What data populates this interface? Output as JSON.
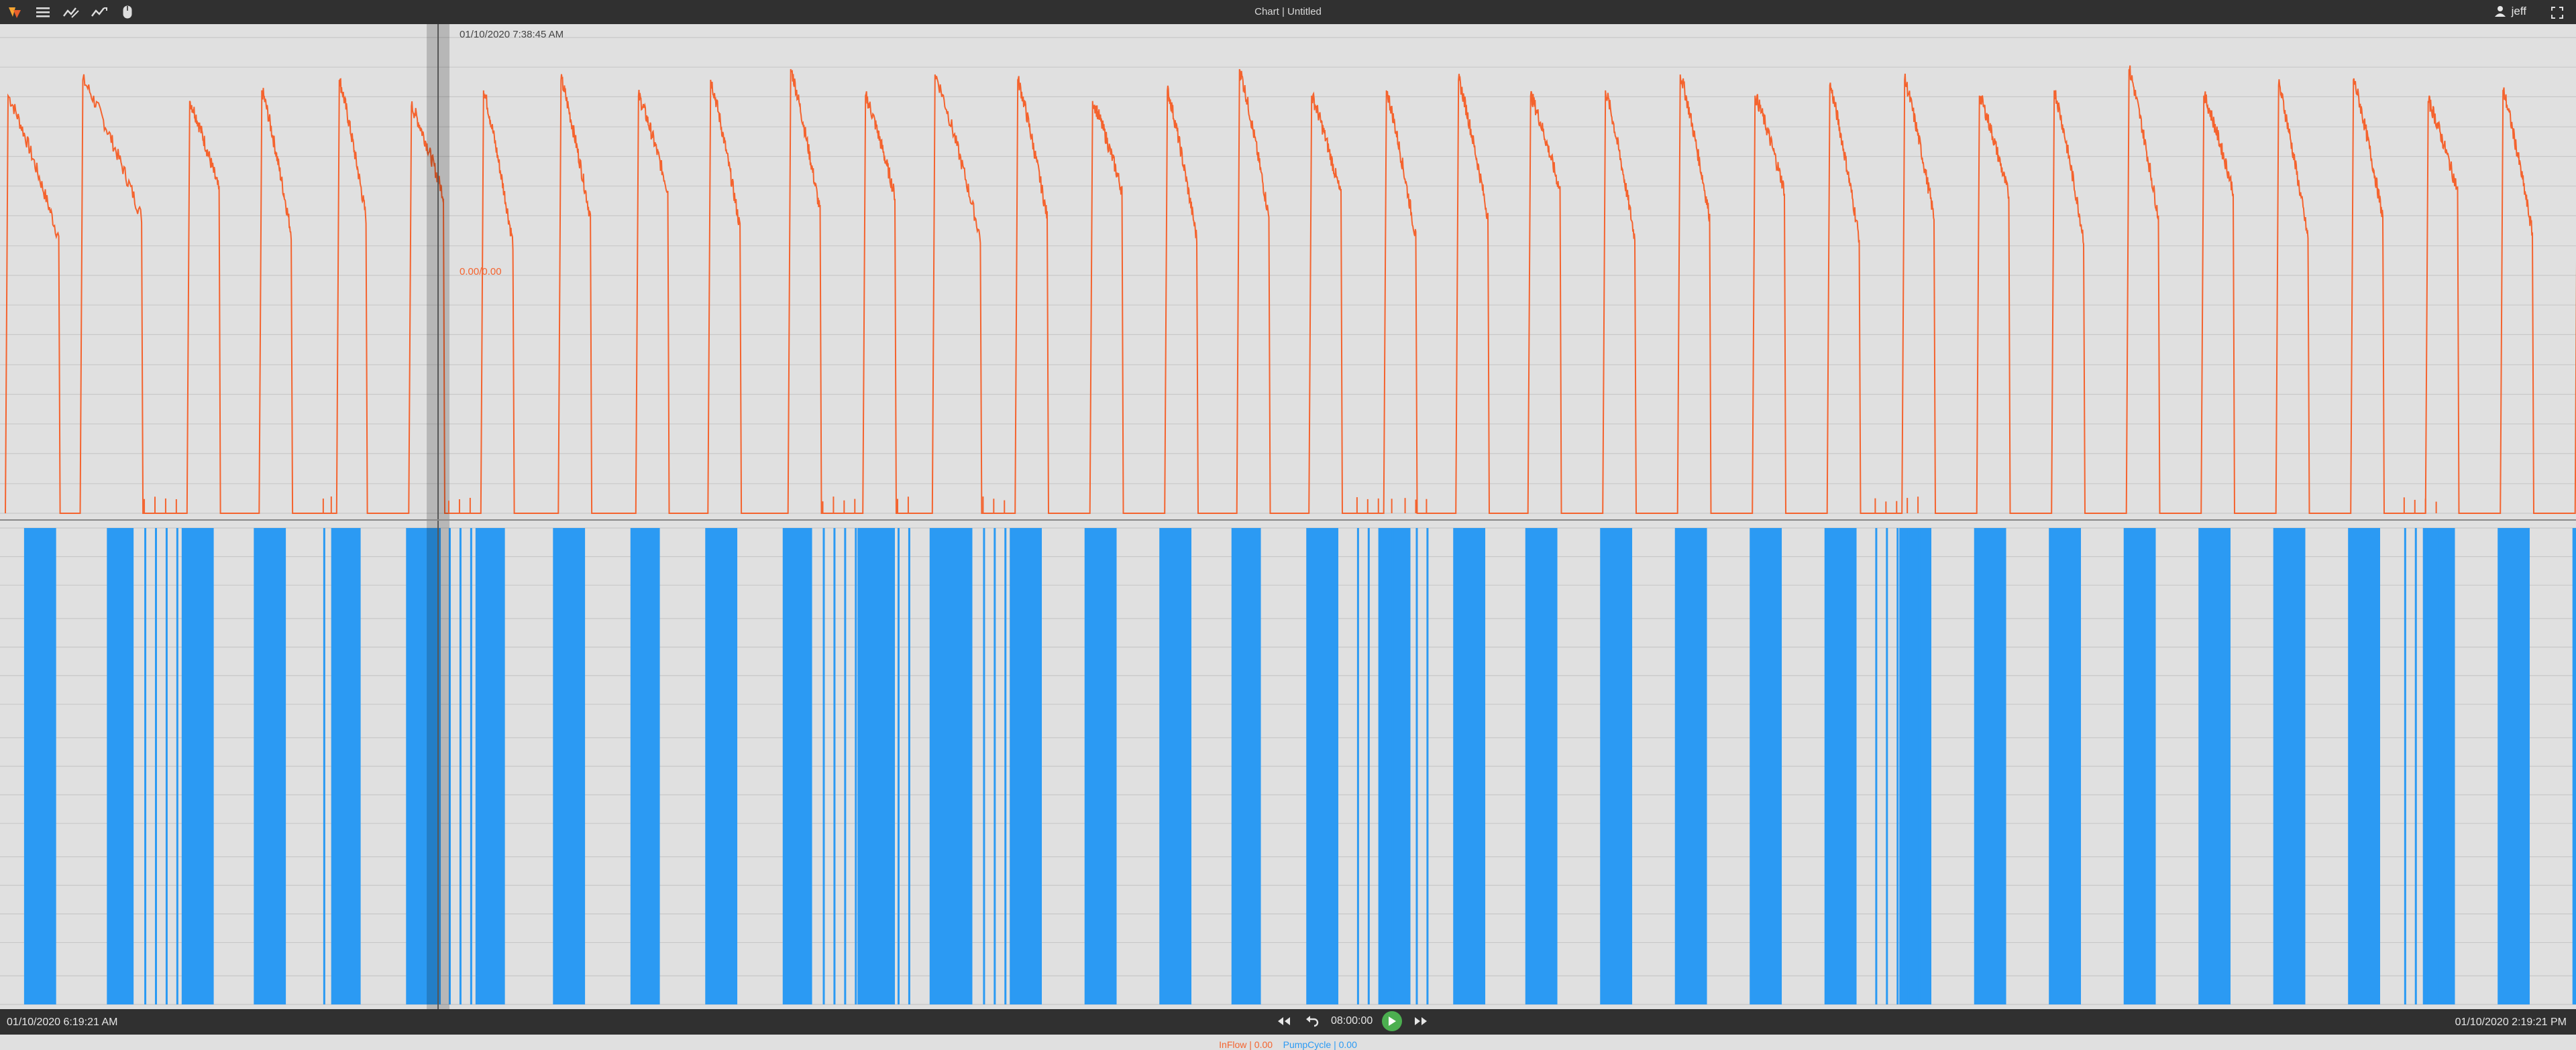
{
  "app": {
    "title": "Chart | Untitled",
    "user": "jeff"
  },
  "toolbar": {
    "icons": [
      "logo-icon",
      "menu-icon",
      "line-chart-icon",
      "line-chart-alt-icon",
      "mouse-icon"
    ]
  },
  "cursor": {
    "timestamp": "01/10/2020 7:38:45 AM",
    "readout": "0.00/0.00"
  },
  "timeline": {
    "start": "01/10/2020 6:19:21 AM",
    "end": "01/10/2020 2:19:21 PM",
    "duration": "08:00:00"
  },
  "legend": [
    {
      "label": "InFlow | 0.00",
      "color": "#f4632e"
    },
    {
      "label": "PumpCycle | 0.00",
      "color": "#2b9af3"
    }
  ],
  "colors": {
    "inflow": "#f4632e",
    "pump": "#2b9af3",
    "background": "#e0e0e0",
    "bar": "#303030"
  },
  "chart_data": [
    {
      "type": "line",
      "series": [
        {
          "name": "InFlow"
        }
      ],
      "yticks": [
        0,
        56,
        113,
        169,
        225,
        281,
        338,
        394,
        450,
        506,
        563,
        619,
        675,
        731,
        788,
        844,
        900
      ],
      "ylim": [
        0,
        900
      ],
      "cycles": [
        {
          "s": 0.0,
          "e": 0.02,
          "pk": 790,
          "lo": 520
        },
        {
          "s": 0.028,
          "e": 0.051,
          "pk": 820,
          "lo": 560
        },
        {
          "s": 0.068,
          "e": 0.08,
          "pk": 780,
          "lo": 610
        },
        {
          "s": 0.095,
          "e": 0.107,
          "pk": 800,
          "lo": 530
        },
        {
          "s": 0.124,
          "e": 0.135,
          "pk": 820,
          "lo": 560
        },
        {
          "s": 0.151,
          "e": 0.164,
          "pk": 770,
          "lo": 600
        },
        {
          "s": 0.178,
          "e": 0.19,
          "pk": 800,
          "lo": 510
        },
        {
          "s": 0.207,
          "e": 0.219,
          "pk": 820,
          "lo": 560
        },
        {
          "s": 0.236,
          "e": 0.248,
          "pk": 790,
          "lo": 610
        },
        {
          "s": 0.263,
          "e": 0.275,
          "pk": 820,
          "lo": 540
        },
        {
          "s": 0.293,
          "e": 0.305,
          "pk": 840,
          "lo": 570
        },
        {
          "s": 0.321,
          "e": 0.333,
          "pk": 790,
          "lo": 600
        },
        {
          "s": 0.347,
          "e": 0.365,
          "pk": 830,
          "lo": 520
        },
        {
          "s": 0.378,
          "e": 0.39,
          "pk": 820,
          "lo": 560
        },
        {
          "s": 0.406,
          "e": 0.418,
          "pk": 780,
          "lo": 610
        },
        {
          "s": 0.434,
          "e": 0.446,
          "pk": 800,
          "lo": 520
        },
        {
          "s": 0.461,
          "e": 0.473,
          "pk": 840,
          "lo": 560
        },
        {
          "s": 0.488,
          "e": 0.5,
          "pk": 790,
          "lo": 600
        },
        {
          "s": 0.516,
          "e": 0.528,
          "pk": 800,
          "lo": 520
        },
        {
          "s": 0.543,
          "e": 0.555,
          "pk": 820,
          "lo": 560
        },
        {
          "s": 0.57,
          "e": 0.582,
          "pk": 790,
          "lo": 610
        },
        {
          "s": 0.598,
          "e": 0.61,
          "pk": 800,
          "lo": 520
        },
        {
          "s": 0.626,
          "e": 0.638,
          "pk": 830,
          "lo": 560
        },
        {
          "s": 0.654,
          "e": 0.666,
          "pk": 790,
          "lo": 610
        },
        {
          "s": 0.682,
          "e": 0.694,
          "pk": 810,
          "lo": 520
        },
        {
          "s": 0.71,
          "e": 0.722,
          "pk": 820,
          "lo": 560
        },
        {
          "s": 0.738,
          "e": 0.75,
          "pk": 790,
          "lo": 600
        },
        {
          "s": 0.766,
          "e": 0.778,
          "pk": 800,
          "lo": 520
        },
        {
          "s": 0.794,
          "e": 0.806,
          "pk": 840,
          "lo": 560
        },
        {
          "s": 0.822,
          "e": 0.834,
          "pk": 790,
          "lo": 610
        },
        {
          "s": 0.85,
          "e": 0.862,
          "pk": 810,
          "lo": 520
        },
        {
          "s": 0.878,
          "e": 0.89,
          "pk": 820,
          "lo": 560
        },
        {
          "s": 0.906,
          "e": 0.918,
          "pk": 780,
          "lo": 610
        },
        {
          "s": 0.934,
          "e": 0.946,
          "pk": 800,
          "lo": 530
        },
        {
          "s": 0.962,
          "e": 0.976,
          "pk": 830,
          "lo": 570
        }
      ]
    },
    {
      "type": "bar",
      "series": [
        {
          "name": "PumpCycle"
        }
      ],
      "yticks": [
        "1.00",
        "0.94",
        "0.88",
        "0.81",
        "0.75",
        "0.69",
        "0.63",
        "0.56",
        "0.50",
        "0.44",
        "0.38",
        "0.31",
        "0.25",
        "0.19",
        "0.13",
        "0.06",
        "0.00"
      ],
      "ylim": [
        0,
        1
      ],
      "on_intervals": [
        [
          0.007,
          0.019
        ],
        [
          0.038,
          0.048
        ],
        [
          0.066,
          0.078
        ],
        [
          0.093,
          0.105
        ],
        [
          0.122,
          0.133
        ],
        [
          0.15,
          0.163
        ],
        [
          0.176,
          0.187
        ],
        [
          0.205,
          0.217
        ],
        [
          0.234,
          0.245
        ],
        [
          0.262,
          0.274
        ],
        [
          0.291,
          0.302
        ],
        [
          0.319,
          0.333
        ],
        [
          0.346,
          0.362
        ],
        [
          0.376,
          0.388
        ],
        [
          0.404,
          0.416
        ],
        [
          0.432,
          0.444
        ],
        [
          0.459,
          0.47
        ],
        [
          0.487,
          0.499
        ],
        [
          0.514,
          0.526
        ],
        [
          0.542,
          0.554
        ],
        [
          0.569,
          0.581
        ],
        [
          0.597,
          0.609
        ],
        [
          0.625,
          0.637
        ],
        [
          0.653,
          0.665
        ],
        [
          0.681,
          0.693
        ],
        [
          0.709,
          0.721
        ],
        [
          0.737,
          0.749
        ],
        [
          0.765,
          0.777
        ],
        [
          0.793,
          0.805
        ],
        [
          0.821,
          0.833
        ],
        [
          0.849,
          0.861
        ],
        [
          0.877,
          0.889
        ],
        [
          0.905,
          0.917
        ],
        [
          0.933,
          0.945
        ],
        [
          0.961,
          0.977
        ]
      ],
      "spikes": [
        0.052,
        0.056,
        0.06,
        0.064,
        0.119,
        0.122,
        0.166,
        0.17,
        0.174,
        0.306,
        0.31,
        0.314,
        0.318,
        0.334,
        0.338,
        0.366,
        0.37,
        0.374,
        0.506,
        0.51,
        0.514,
        0.519,
        0.524,
        0.528,
        0.532,
        0.7,
        0.704,
        0.708,
        0.712,
        0.716,
        0.898,
        0.902,
        0.906,
        0.91,
        0.966
      ]
    }
  ]
}
